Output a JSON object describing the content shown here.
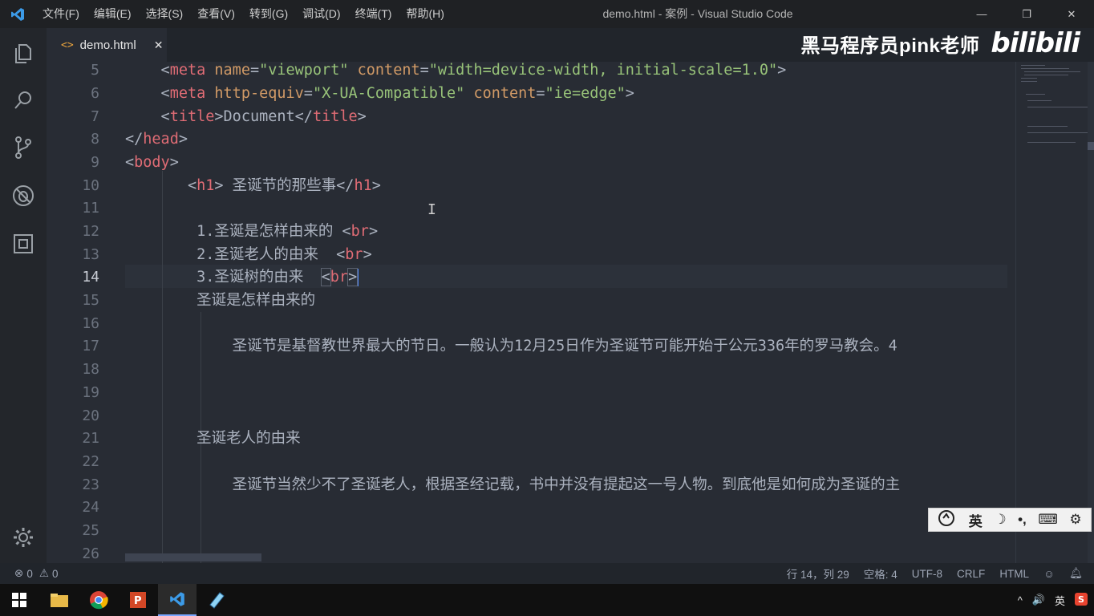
{
  "window": {
    "title": "demo.html - 案例 - Visual Studio Code",
    "minimize": "—",
    "maximize": "❐",
    "close": "✕"
  },
  "menu": [
    "文件(F)",
    "编辑(E)",
    "选择(S)",
    "查看(V)",
    "转到(G)",
    "调试(D)",
    "终端(T)",
    "帮助(H)"
  ],
  "tab": {
    "label": "demo.html",
    "icon": "<>",
    "close": "✕"
  },
  "watermark": {
    "text": "黑马程序员pink老师",
    "logo": "bilibili"
  },
  "editor": {
    "active_line": 14,
    "line_numbers": [
      5,
      6,
      7,
      8,
      9,
      10,
      11,
      12,
      13,
      14,
      15,
      16,
      17,
      18,
      19,
      20,
      21,
      22,
      23,
      24,
      25,
      26
    ],
    "line5": {
      "pre": "    <",
      "tag": "meta",
      "a1": "name",
      "eq1": "=",
      "s1": "\"viewport\"",
      "a2": "content",
      "eq2": "=",
      "s2": "\"width=device-width, initial-scale=1.0\"",
      "end": ">"
    },
    "line6": {
      "pre": "    <",
      "tag": "meta",
      "a1": "http-equiv",
      "eq1": "=",
      "s1": "\"X-UA-Compatible\"",
      "a2": "content",
      "eq2": "=",
      "s2": "\"ie=edge\"",
      "end": ">"
    },
    "line7": {
      "pre": "    <",
      "tag": "title",
      "mid": ">Document</",
      "tag2": "title",
      "end": ">"
    },
    "line8": {
      "pre": "</",
      "tag": "head",
      "end": ">"
    },
    "line9": {
      "pre": "<",
      "tag": "body",
      "end": ">"
    },
    "line10": {
      "pre": "       <",
      "tag": "h1",
      "mid": "> 圣诞节的那些事</",
      "tag2": "h1",
      "end": ">"
    },
    "line12": {
      "text": "        1.圣诞是怎样由来的 <",
      "tag": "br",
      "end": ">"
    },
    "line13": {
      "text": "        2.圣诞老人的由来  <",
      "tag": "br",
      "end": ">"
    },
    "line14": {
      "text": "        3.圣诞树的由来  ",
      "lt": "<",
      "tag": "br",
      "end": ">"
    },
    "line15": {
      "text": "        圣诞是怎样由来的"
    },
    "line17": {
      "text": "            圣诞节是基督教世界最大的节日。一般认为12月25日作为圣诞节可能开始于公元336年的罗马教会。4"
    },
    "line21": {
      "text": "        圣诞老人的由来"
    },
    "line23": {
      "text": "            圣诞节当然少不了圣诞老人，根据圣经记载，书中并没有提起这一号人物。到底他是如何成为圣诞的主"
    }
  },
  "ime": {
    "lang": "英",
    "moon": "☽",
    "punct": "•,",
    "keyboard": "⌨",
    "settings": "⚙"
  },
  "status": {
    "errors": "0",
    "warnings": "0",
    "position": "行 14，列 29",
    "spaces": "空格: 4",
    "encoding": "UTF-8",
    "eol": "CRLF",
    "language": "HTML"
  },
  "taskbar": {
    "tray_lang": "英",
    "volume": "🔊",
    "up": "^"
  }
}
